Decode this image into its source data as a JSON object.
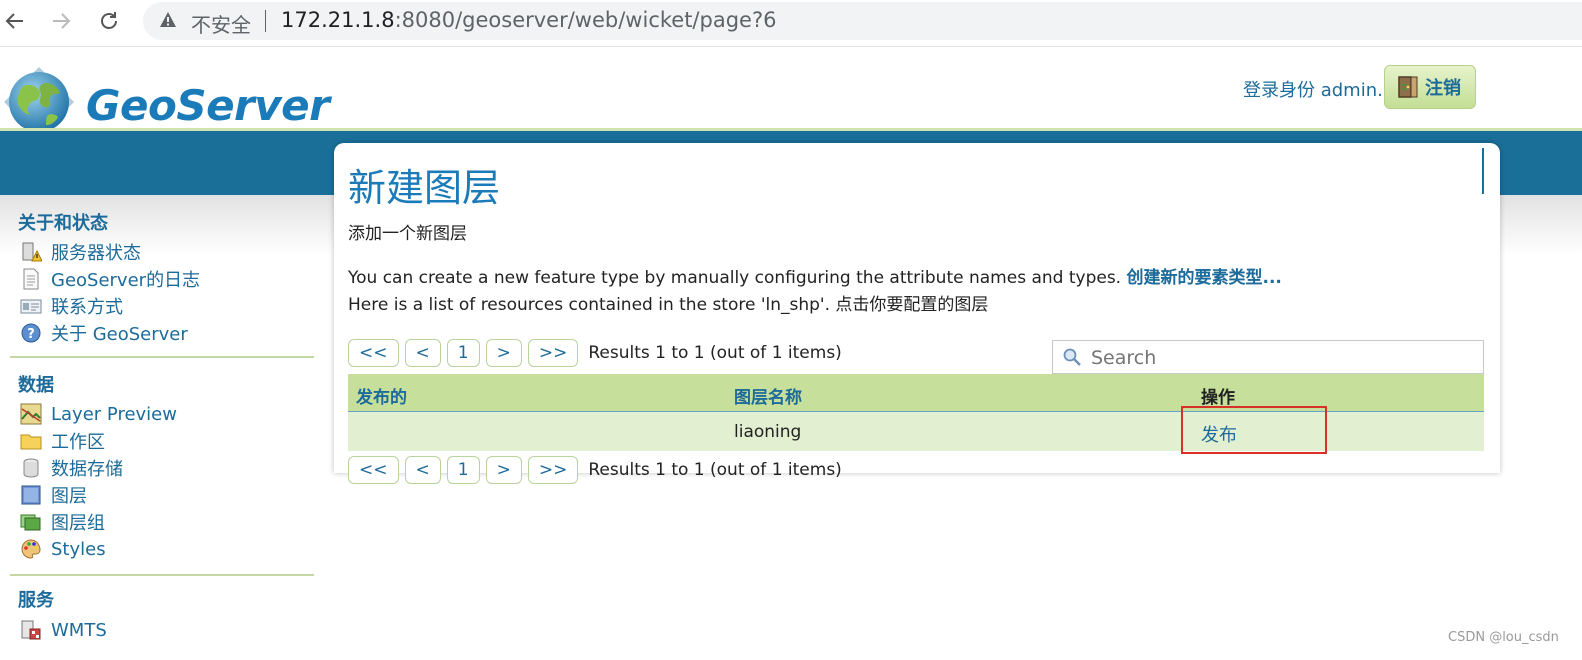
{
  "browser": {
    "security_label": "不安全",
    "url_host": "172.21.1.8",
    "url_rest": ":8080/geoserver/web/wicket/page?6"
  },
  "header": {
    "logo_text": "GeoServer",
    "login_label": "登录身份 admin.",
    "logout_label": "注销"
  },
  "sidebar": {
    "sections": [
      {
        "title": "关于和状态",
        "items": [
          "服务器状态",
          "GeoServer的日志",
          "联系方式",
          "关于 GeoServer"
        ]
      },
      {
        "title": "数据",
        "items": [
          "Layer Preview",
          "工作区",
          "数据存储",
          "图层",
          "图层组",
          "Styles"
        ]
      },
      {
        "title": "服务",
        "items": [
          "WMTS"
        ]
      }
    ]
  },
  "content": {
    "title": "新建图层",
    "subtitle": "添加一个新图层",
    "desc1": "You can create a new feature type by manually configuring the attribute names and types.",
    "desc1_link": "创建新的要素类型...",
    "desc2": "Here is a list of resources contained in the store 'ln_shp'. 点击你要配置的图层",
    "pager": {
      "first": "<<",
      "prev": "<",
      "page": "1",
      "next": ">",
      "last": ">>",
      "results": "Results 1 to 1 (out of 1 items)"
    },
    "search_placeholder": "Search",
    "table": {
      "headers": [
        "发布的",
        "图层名称",
        "操作"
      ],
      "rows": [
        {
          "published": "",
          "layer_name": "liaoning",
          "action": "发布"
        }
      ]
    }
  },
  "watermark": "CSDN @lou_csdn",
  "colors": {
    "brand_blue": "#1b7ab8",
    "band_blue": "#1a6f98",
    "table_green": "#c6df9b",
    "highlight_red": "#d9302a"
  }
}
